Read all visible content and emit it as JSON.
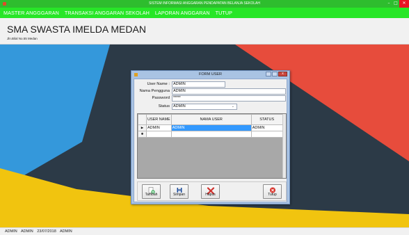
{
  "window": {
    "title": "SISTEM INFORMASI ANGGARAN PENDAPATAN BELANJA SEKOLAH",
    "min_glyph": "–",
    "max_glyph": "□",
    "close_glyph": "✕"
  },
  "menu": {
    "items": [
      {
        "label": "MASTER ANGGGARAN"
      },
      {
        "label": "TRANSAKSI ANGGARAN SEKOLAH"
      },
      {
        "label": "LAPORAN ANGGARAN"
      },
      {
        "label": "TUTUP"
      }
    ]
  },
  "header": {
    "school_name": "SMA SWASTA IMELDA MEDAN",
    "address": "Jln.Bilal No.55 Medan"
  },
  "dialog": {
    "title": "FORM USER",
    "close_glyph": "x",
    "form": {
      "user_name_label": "User Name :",
      "user_name_value": "ADMIN",
      "nama_pengguna_label": "Nama Pengguna",
      "nama_pengguna_value": "ADMIN",
      "password_label": "Password",
      "password_value": "*****",
      "status_label": "Status",
      "status_value": "ADMIN",
      "status_arrow": "⌄"
    },
    "grid": {
      "columns": [
        "USER NAME",
        "NAMA USER",
        "STATUS"
      ],
      "rows": [
        {
          "indicator": "▶",
          "user_name": "ADMIN",
          "nama_user": "ADMIN",
          "status": "ADMIN"
        },
        {
          "indicator": "✱",
          "user_name": "",
          "nama_user": "",
          "status": ""
        }
      ]
    },
    "buttons": {
      "tambah": "Tambah",
      "simpan": "Simpan",
      "hapus": "Hapus",
      "tutup": "Tutup"
    }
  },
  "statusbar": {
    "items": [
      "ADMIN",
      "ADMIN",
      "23/07/2018",
      "ADMIN"
    ]
  },
  "colors": {
    "titlebar": "#2ebd2e",
    "menubar": "#27e627",
    "bg_dark": "#2c3a47",
    "bg_blue": "#3498db",
    "bg_red": "#e74c3c",
    "bg_yellow": "#f1c40f",
    "selection": "#3399ff"
  },
  "icons": {
    "tambah": "add-page-icon",
    "simpan": "save-disk-icon",
    "hapus": "delete-x-icon",
    "tutup": "close-circle-icon"
  }
}
